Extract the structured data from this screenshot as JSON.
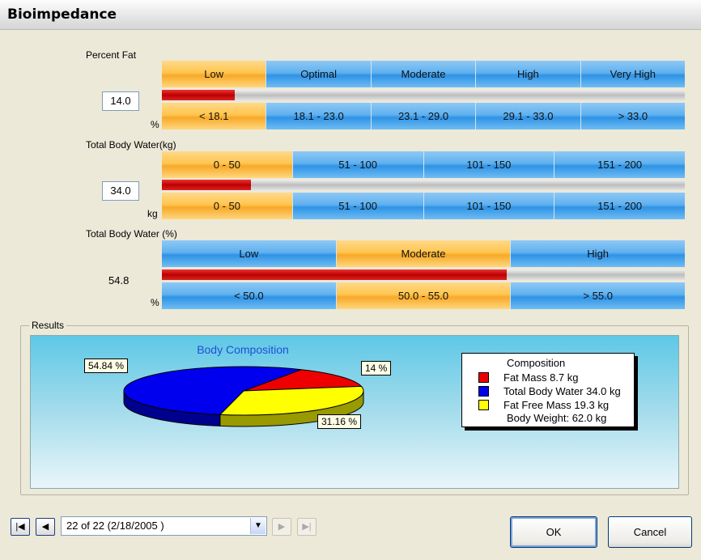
{
  "window": {
    "title": "Bioimpedance"
  },
  "percent_fat": {
    "label": "Percent Fat",
    "value": "14.0",
    "unit": "%",
    "level": 0.14,
    "top_bands": [
      "Low",
      "Optimal",
      "Moderate",
      "High",
      "Very High"
    ],
    "bottom_bands": [
      "< 18.1",
      "18.1 - 23.0",
      "23.1 - 29.0",
      "29.1 - 33.0",
      "> 33.0"
    ],
    "selected_index": 0
  },
  "tbw_kg": {
    "label": "Total Body Water(kg)",
    "value": "34.0",
    "unit": "kg",
    "level": 0.17,
    "top_bands": [
      "0 - 50",
      "51 - 100",
      "101 - 150",
      "151 - 200"
    ],
    "bottom_bands": [
      "0 - 50",
      "51 - 100",
      "101 - 150",
      "151 - 200"
    ],
    "selected_index": 0
  },
  "tbw_pct": {
    "label": "Total Body Water (%)",
    "value": "54.8",
    "unit": "%",
    "level": 0.66,
    "top_bands": [
      "Low",
      "Moderate",
      "High"
    ],
    "bottom_bands": [
      "< 50.0",
      "50.0 - 55.0",
      "> 55.0"
    ],
    "selected_index": 1
  },
  "results": {
    "group_title": "Results",
    "chart_title": "Body Composition",
    "legend_title": "Composition",
    "legend_items": [
      {
        "label": "Fat Mass 8.7 kg",
        "color": "#ee0000"
      },
      {
        "label": "Total Body Water 34.0 kg",
        "color": "#0000ee"
      },
      {
        "label": "Fat Free Mass 19.3 kg",
        "color": "#ffff00"
      }
    ],
    "body_weight": "Body Weight: 62.0 kg",
    "callouts": {
      "water": "54.84 %",
      "fat": "14 %",
      "free": "31.16 %"
    }
  },
  "chart_data": {
    "type": "pie",
    "title": "Body Composition",
    "categories": [
      "Fat Mass",
      "Total Body Water",
      "Fat Free Mass"
    ],
    "values": [
      14,
      54.84,
      31.16
    ],
    "colors": [
      "#ee0000",
      "#0000ee",
      "#ffff00"
    ]
  },
  "navigation": {
    "record": "22 of 22  (2/18/2005 )",
    "first_icon": "first-record-icon",
    "prev_icon": "previous-record-icon",
    "next_icon": "next-record-icon",
    "last_icon": "last-record-icon"
  },
  "buttons": {
    "ok": "OK",
    "cancel": "Cancel"
  }
}
